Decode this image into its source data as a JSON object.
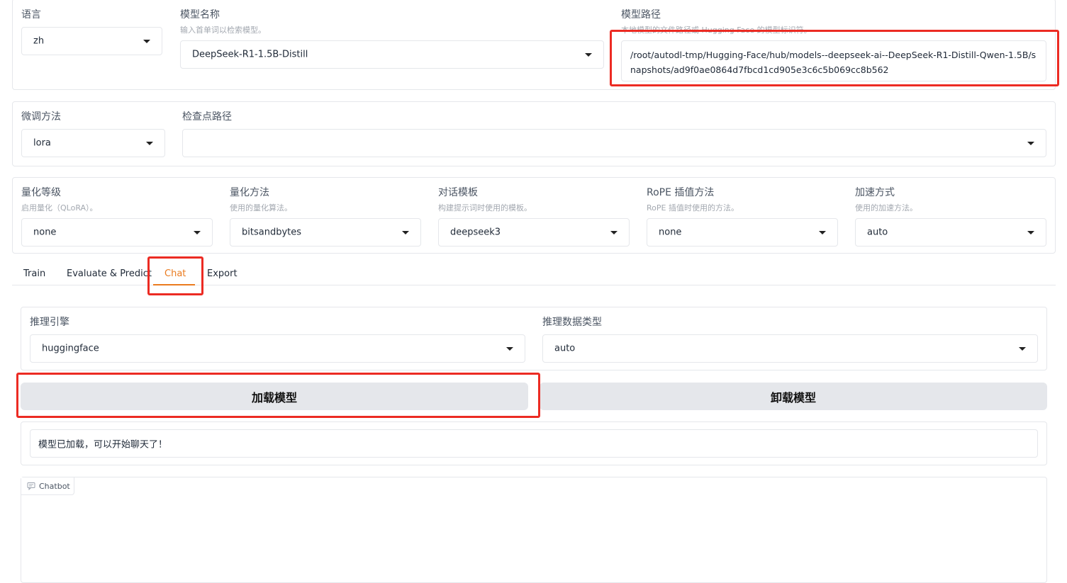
{
  "top": {
    "language": {
      "label": "语言",
      "value": "zh"
    },
    "model_name": {
      "label": "模型名称",
      "hint": "输入首单词以检索模型。",
      "value": "DeepSeek-R1-1.5B-Distill"
    },
    "model_path": {
      "label": "模型路径",
      "hint": "本地模型的文件路径或 Hugging Face 的模型标识符。",
      "value": "/root/autodl-tmp/Hugging-Face/hub/models--deepseek-ai--DeepSeek-R1-Distill-Qwen-1.5B/snapshots/ad9f0ae0864d7fbcd1cd905e3c6c5b069cc8b562"
    }
  },
  "finetune": {
    "method": {
      "label": "微调方法",
      "value": "lora"
    },
    "checkpoint": {
      "label": "检查点路径",
      "value": ""
    }
  },
  "quant": {
    "level": {
      "label": "量化等级",
      "hint": "启用量化（QLoRA）。",
      "value": "none"
    },
    "method": {
      "label": "量化方法",
      "hint": "使用的量化算法。",
      "value": "bitsandbytes"
    },
    "template": {
      "label": "对话模板",
      "hint": "构建提示词时使用的模板。",
      "value": "deepseek3"
    },
    "rope": {
      "label": "RoPE 插值方法",
      "hint": "RoPE 插值时使用的方法。",
      "value": "none"
    },
    "booster": {
      "label": "加速方式",
      "hint": "使用的加速方法。",
      "value": "auto"
    }
  },
  "tabs": [
    "Train",
    "Evaluate & Predict",
    "Chat",
    "Export"
  ],
  "chat": {
    "engine": {
      "label": "推理引擎",
      "value": "huggingface"
    },
    "dtype": {
      "label": "推理数据类型",
      "value": "auto"
    },
    "load_button": "加载模型",
    "unload_button": "卸载模型",
    "status": "模型已加载，可以开始聊天了！",
    "chatbot_label": "Chatbot"
  },
  "colors": {
    "accent": "#ea7b1f",
    "highlight": "#ec2b23",
    "button_bg": "#e5e7eb"
  }
}
